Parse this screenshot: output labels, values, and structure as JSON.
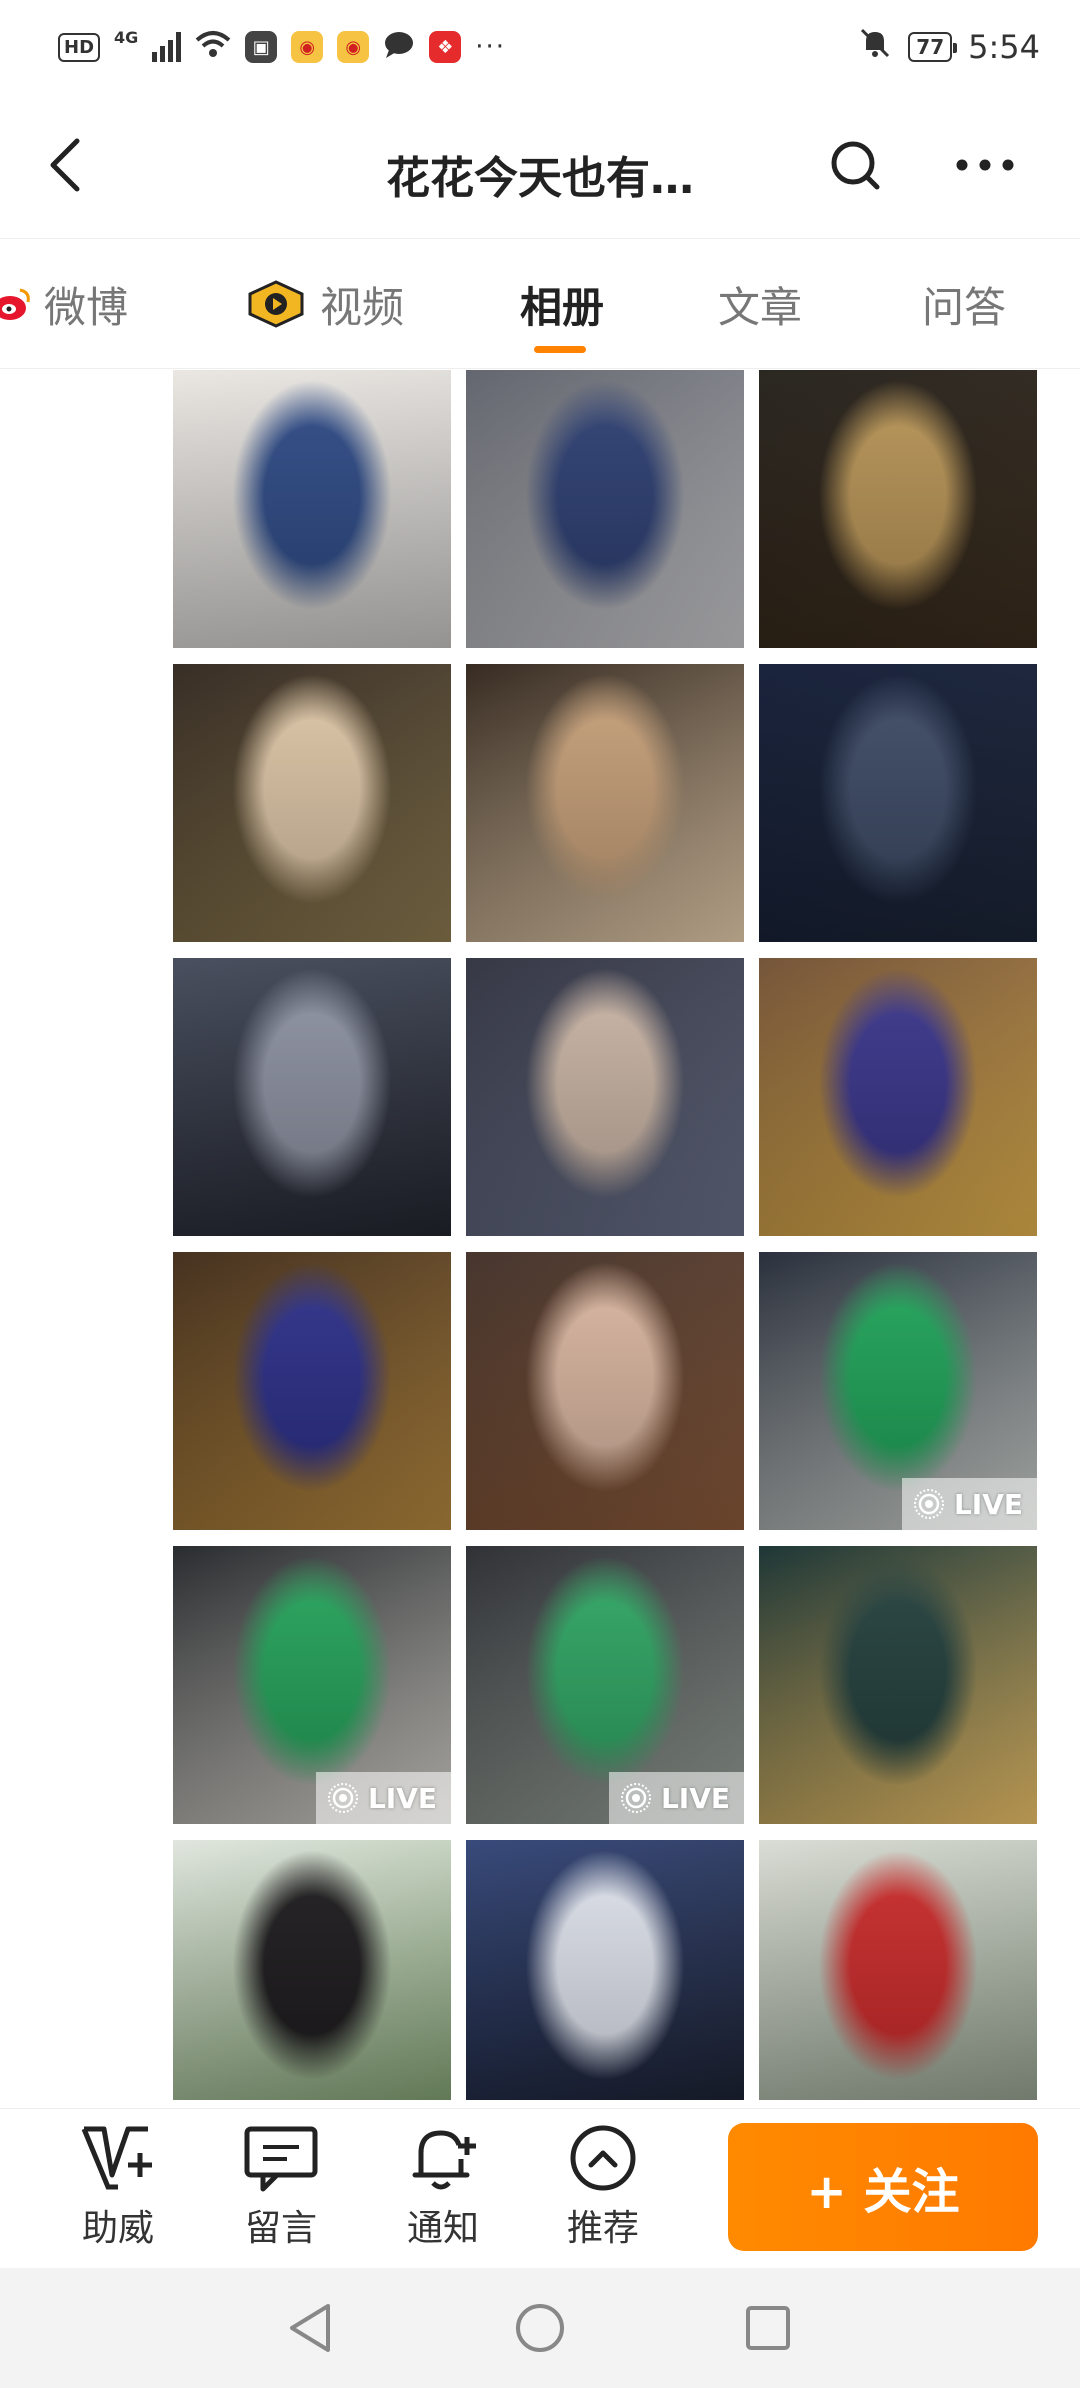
{
  "status_bar": {
    "hd_label": "HD",
    "network_label": "4G",
    "battery": "77",
    "time": "5:54"
  },
  "header": {
    "title": "花花今天也有…"
  },
  "tabs": [
    {
      "label": "微博",
      "icon": "weibo-icon",
      "active": false
    },
    {
      "label": "视频",
      "icon": "video-icon",
      "active": false
    },
    {
      "label": "相册",
      "active": true
    },
    {
      "label": "文章",
      "active": false
    },
    {
      "label": "问答",
      "active": false
    }
  ],
  "photos": [
    {
      "live": false,
      "colors": [
        "#e9e6e1",
        "#2e4b87",
        "#c6c4c2"
      ]
    },
    {
      "live": false,
      "colors": [
        "#5a5d66",
        "#2d3f73",
        "#c9c9cc"
      ]
    },
    {
      "live": false,
      "colors": [
        "#1e1a14",
        "#b99556",
        "#3b2c1c"
      ]
    },
    {
      "live": false,
      "colors": [
        "#2b2118",
        "#e0c8a8",
        "#8d7a50"
      ]
    },
    {
      "live": false,
      "colors": [
        "#2a1e14",
        "#c9a27a",
        "#e8cfae"
      ]
    },
    {
      "live": false,
      "colors": [
        "#0c1630",
        "#3d4b66",
        "#1b2436"
      ]
    },
    {
      "live": false,
      "colors": [
        "#3f4556",
        "#8e93a3",
        "#22252e"
      ]
    },
    {
      "live": false,
      "colors": [
        "#2a2c3a",
        "#cbb6a6",
        "#697089"
      ]
    },
    {
      "live": false,
      "colors": [
        "#6d4b2e",
        "#3a358c",
        "#e2b24e"
      ]
    },
    {
      "live": false,
      "colors": [
        "#3a2512",
        "#2c2f8a",
        "#b7893f"
      ]
    },
    {
      "live": false,
      "colors": [
        "#3c2a22",
        "#dcb8a2",
        "#8b5a3a"
      ]
    },
    {
      "live": true,
      "live_label": "LIVE",
      "colors": [
        "#1d2330",
        "#1fa65a",
        "#cfd4cf"
      ]
    },
    {
      "live": true,
      "live_label": "LIVE",
      "colors": [
        "#1c1f22",
        "#24a55b",
        "#d9d6cf"
      ]
    },
    {
      "live": true,
      "live_label": "LIVE",
      "colors": [
        "#23252a",
        "#2fa864",
        "#9aa39b"
      ]
    },
    {
      "live": false,
      "colors": [
        "#0f2a2a",
        "#23403d",
        "#f0c46a"
      ]
    },
    {
      "live": false,
      "colors": [
        "#dfe5dd",
        "#1c1a1c",
        "#7a9a6b"
      ]
    },
    {
      "live": false,
      "colors": [
        "#2c3f73",
        "#e0e4ee",
        "#1a1f2e"
      ]
    },
    {
      "live": false,
      "colors": [
        "#d7dbd3",
        "#cc2a2a",
        "#8f9b88"
      ]
    }
  ],
  "toolbar": {
    "items": [
      {
        "label": "助威",
        "icon": "cheer-icon"
      },
      {
        "label": "留言",
        "icon": "message-icon"
      },
      {
        "label": "通知",
        "icon": "notification-icon"
      },
      {
        "label": "推荐",
        "icon": "recommend-icon"
      }
    ],
    "follow_label": "+ 关注",
    "accent": "#ff8200"
  }
}
